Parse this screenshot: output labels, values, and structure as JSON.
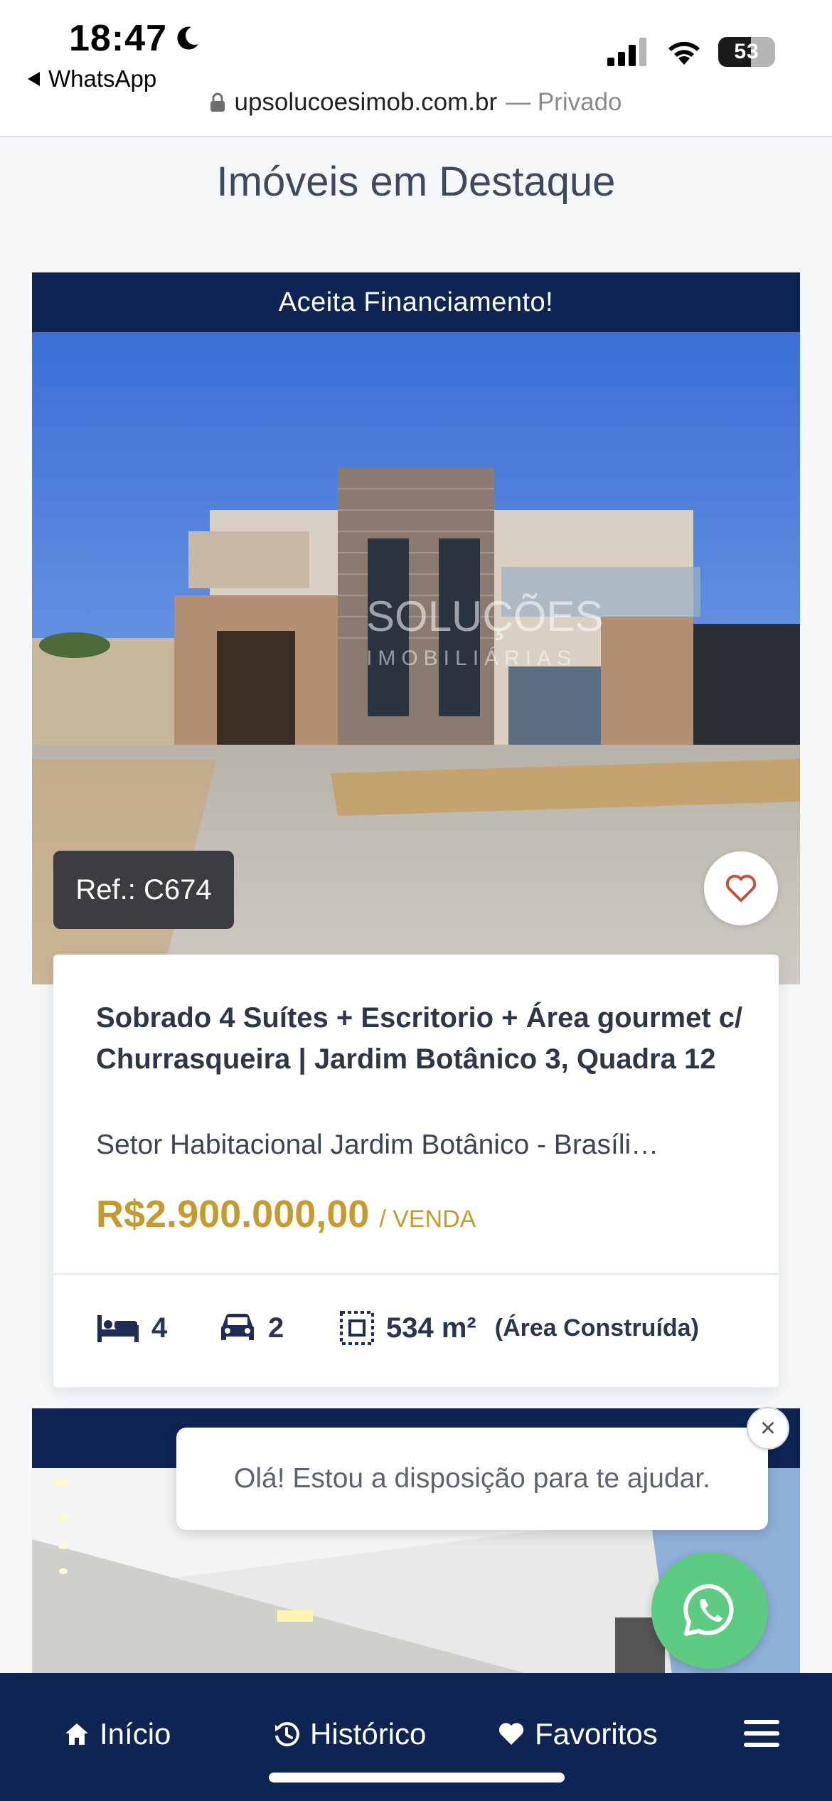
{
  "status_bar": {
    "time": "18:47",
    "back_app": "WhatsApp",
    "battery": "53"
  },
  "browser": {
    "url": "upsolucoesimob.com.br",
    "mode": "— Privado"
  },
  "section": {
    "title": "Imóveis em Destaque"
  },
  "listing1": {
    "banner": "Aceita Financiamento!",
    "watermark_line1": "SOLUÇÕES",
    "watermark_line2": "IMOBILIÁRIAS",
    "ref": "Ref.: C674",
    "title": "Sobrado 4 Suítes + Escritorio + Área gourmet c/ Churrasqueira | Jardim Botânico 3, Quadra 12",
    "location": "Setor Habitacional Jardim Botânico - Brasíli…",
    "price": "R$2.900.000,00",
    "price_type": "/ VENDA",
    "bedrooms": "4",
    "parking": "2",
    "area": "534 m²",
    "area_label": "(Área Construída)"
  },
  "chat": {
    "message": "Olá! Estou a disposição para te ajudar.",
    "close": "×"
  },
  "bottom_nav": {
    "items": [
      {
        "label": "Início",
        "icon": "home-icon"
      },
      {
        "label": "Histórico",
        "icon": "history-icon"
      },
      {
        "label": "Favoritos",
        "icon": "heart-icon"
      },
      {
        "label": "",
        "icon": "menu-icon"
      }
    ]
  },
  "colors": {
    "navy": "#0e2452",
    "gold": "#c79a2d",
    "whatsapp": "#5ecb83"
  }
}
